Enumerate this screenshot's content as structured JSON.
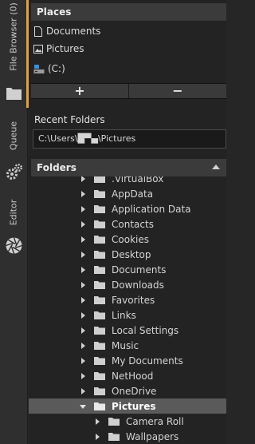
{
  "sidebar": {
    "tabs": [
      {
        "label": "File Browser (0)"
      },
      {
        "label": "Queue"
      },
      {
        "label": "Editor"
      }
    ],
    "accent_color": "#e3a13d",
    "icons": [
      "folder-icon",
      "gears-icon",
      "aperture-icon"
    ]
  },
  "places": {
    "title": "Places",
    "items": [
      {
        "label": "Documents",
        "icon": "document-icon"
      },
      {
        "label": "Pictures",
        "icon": "picture-icon"
      },
      {
        "label": "(C:)",
        "icon": "drive-icon"
      }
    ],
    "add_label": "+",
    "remove_label": "−"
  },
  "recent": {
    "title": "Recent Folders",
    "value": "C:\\Users\\█▀▄\\Pictures"
  },
  "folders": {
    "title": "Folders",
    "items": [
      {
        "label": ".VirtualBox",
        "level": 1,
        "expanded": false,
        "selected": false
      },
      {
        "label": "AppData",
        "level": 1,
        "expanded": false,
        "selected": false
      },
      {
        "label": "Application Data",
        "level": 1,
        "expanded": false,
        "selected": false
      },
      {
        "label": "Contacts",
        "level": 1,
        "expanded": false,
        "selected": false
      },
      {
        "label": "Cookies",
        "level": 1,
        "expanded": false,
        "selected": false
      },
      {
        "label": "Desktop",
        "level": 1,
        "expanded": false,
        "selected": false
      },
      {
        "label": "Documents",
        "level": 1,
        "expanded": false,
        "selected": false
      },
      {
        "label": "Downloads",
        "level": 1,
        "expanded": false,
        "selected": false
      },
      {
        "label": "Favorites",
        "level": 1,
        "expanded": false,
        "selected": false
      },
      {
        "label": "Links",
        "level": 1,
        "expanded": false,
        "selected": false
      },
      {
        "label": "Local Settings",
        "level": 1,
        "expanded": false,
        "selected": false
      },
      {
        "label": "Music",
        "level": 1,
        "expanded": false,
        "selected": false
      },
      {
        "label": "My Documents",
        "level": 1,
        "expanded": false,
        "selected": false
      },
      {
        "label": "NetHood",
        "level": 1,
        "expanded": false,
        "selected": false
      },
      {
        "label": "OneDrive",
        "level": 1,
        "expanded": false,
        "selected": false
      },
      {
        "label": "Pictures",
        "level": 1,
        "expanded": true,
        "selected": true
      },
      {
        "label": "Camera Roll",
        "level": 2,
        "expanded": false,
        "selected": false
      },
      {
        "label": "Wallpapers",
        "level": 2,
        "expanded": false,
        "selected": false
      }
    ]
  }
}
